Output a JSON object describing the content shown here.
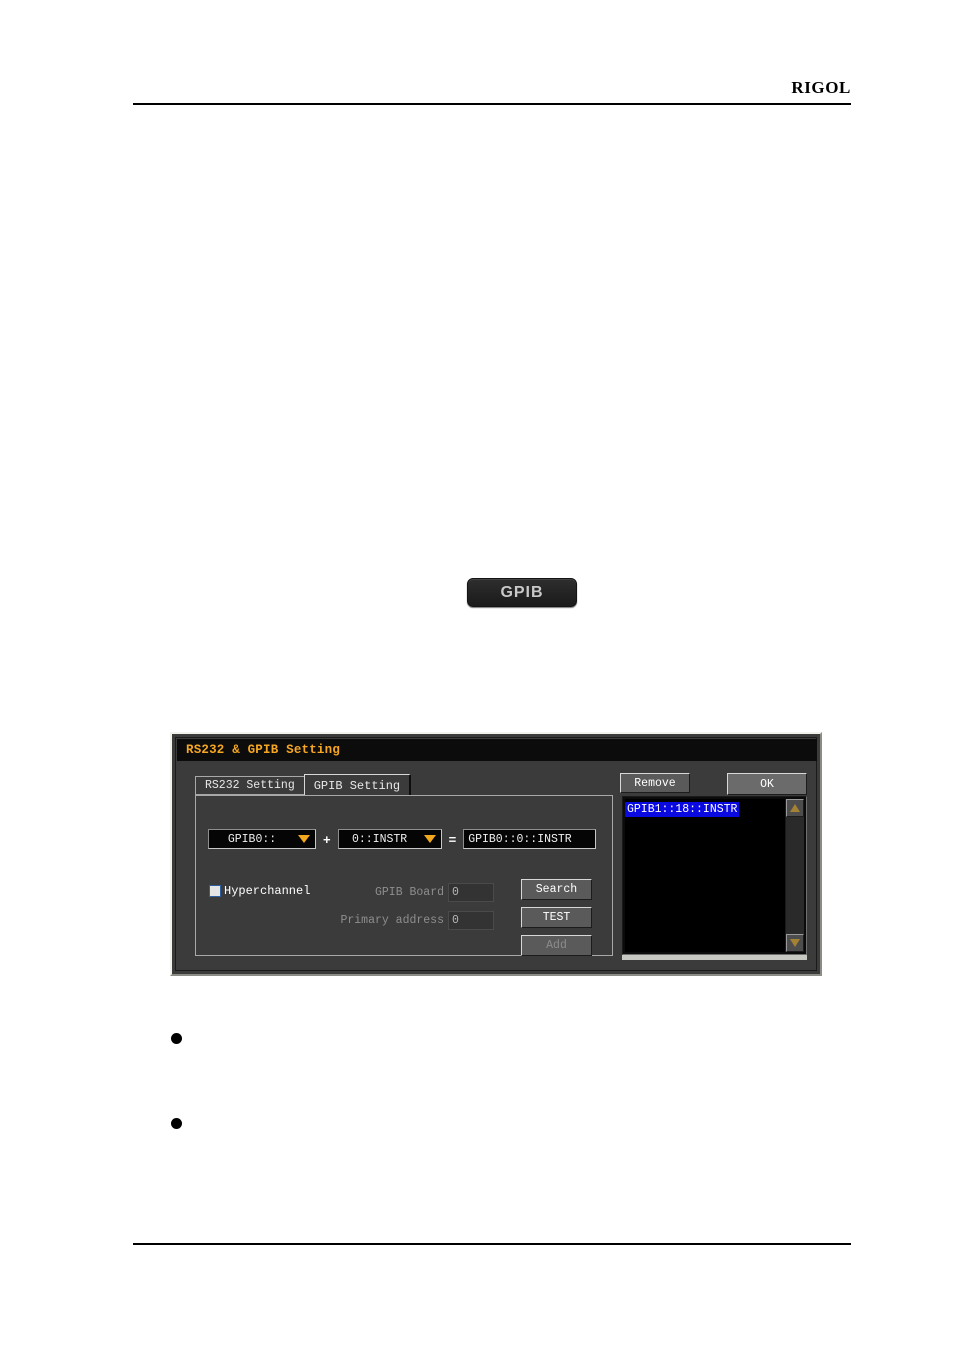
{
  "page": {
    "brand": "RIGOL"
  },
  "hardware_key": {
    "label": "GPIB"
  },
  "bullets": [
    {
      "text": ""
    },
    {
      "text": ""
    }
  ],
  "dialog": {
    "title": "RS232 & GPIB Setting",
    "tabs": [
      {
        "label": "RS232 Setting",
        "active": false
      },
      {
        "label": "GPIB Setting",
        "active": true
      }
    ],
    "header_buttons": {
      "remove": "Remove",
      "ok": "OK"
    },
    "address_builder": {
      "board_combo": {
        "value": "GPIB0::",
        "arrow_icon": "chevron-down-icon"
      },
      "plus_operator": "+",
      "address_combo": {
        "value": "0::INSTR",
        "arrow_icon": "chevron-down-icon"
      },
      "equals_operator": "=",
      "result": "GPIB0::0::INSTR"
    },
    "hyperchannel": {
      "label": "Hyperchannel",
      "checked": false
    },
    "fields": [
      {
        "label": "GPIB Board",
        "value": "0",
        "enabled": false
      },
      {
        "label": "Primary address",
        "value": "0",
        "enabled": false
      }
    ],
    "action_buttons": [
      {
        "label": "Search",
        "enabled": true
      },
      {
        "label": "TEST",
        "enabled": true
      },
      {
        "label": "Add",
        "enabled": false
      }
    ],
    "resource_list": {
      "items": [
        {
          "text": "GPIB1::18::INSTR",
          "selected": true
        }
      ],
      "scroll_up_icon": "triangle-up-icon",
      "scroll_down_icon": "triangle-down-icon"
    }
  },
  "colors": {
    "title_accent": "#f5a623",
    "dropdown_arrow": "#f2a81e",
    "selection": "#0a0ae0",
    "dialog_bg": "#3b3b3b",
    "field_bg": "#050505"
  }
}
